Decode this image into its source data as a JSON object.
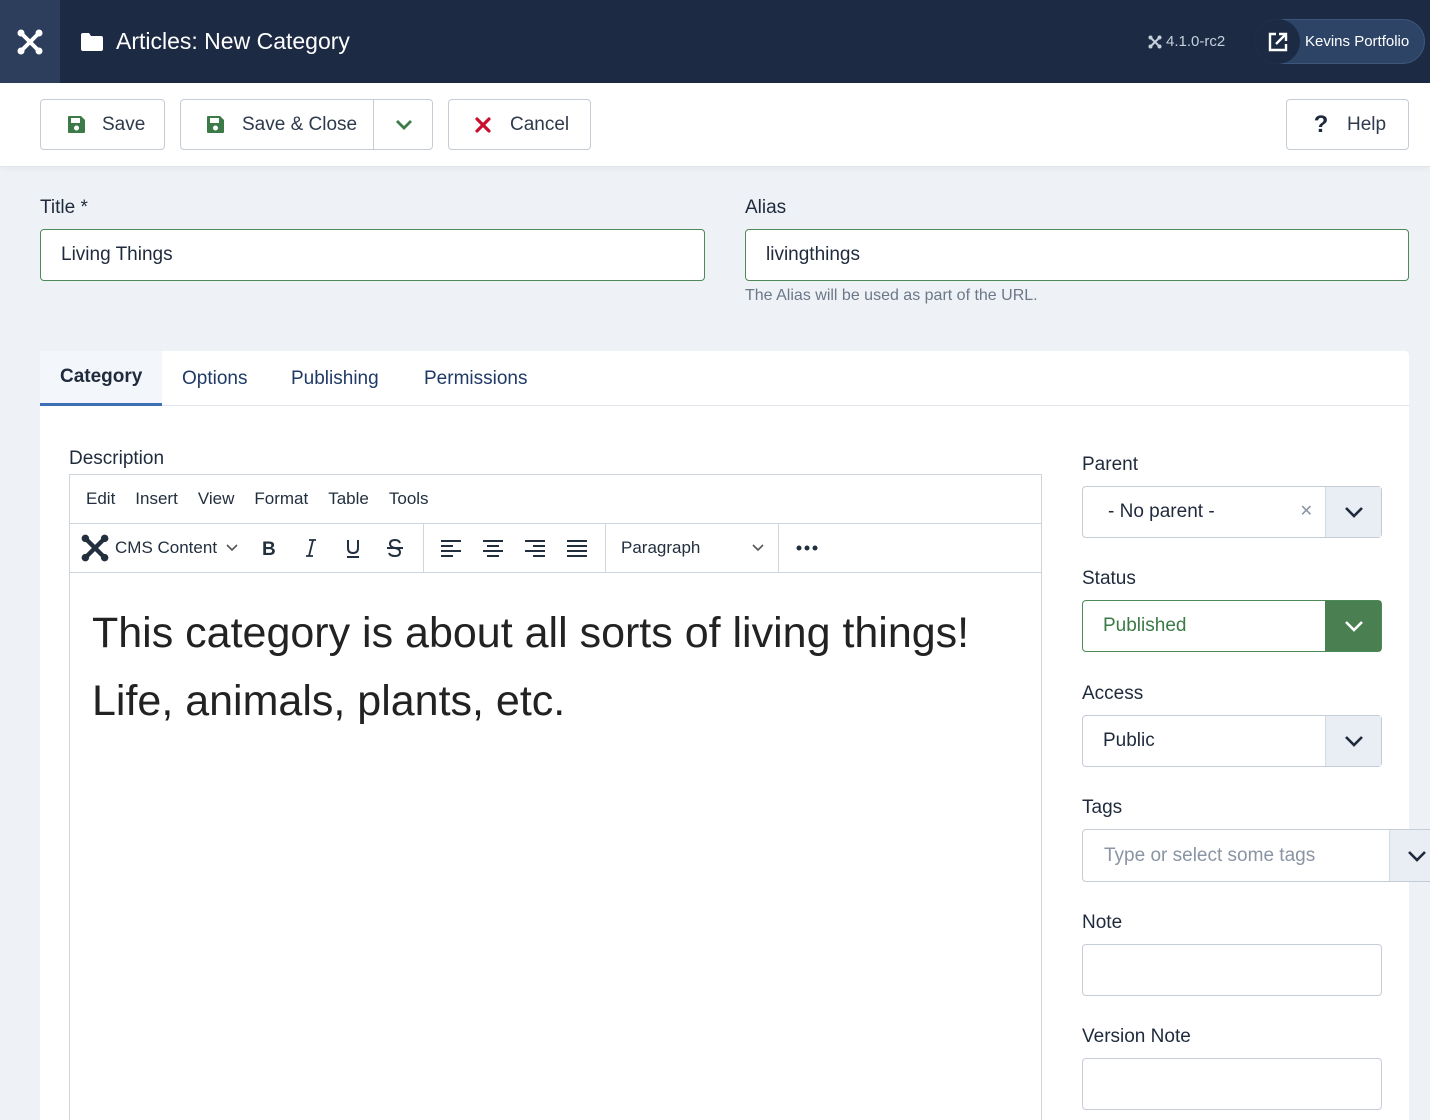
{
  "header": {
    "title": "Articles: New Category",
    "version": "4.1.0-rc2",
    "site_link": "Kevins Portfolio"
  },
  "toolbar": {
    "save_label": "Save",
    "save_close_label": "Save & Close",
    "cancel_label": "Cancel",
    "help_label": "Help"
  },
  "form": {
    "title_label": "Title *",
    "title_value": "Living Things",
    "alias_label": "Alias",
    "alias_value": "livingthings",
    "alias_hint": "The Alias will be used as part of the URL."
  },
  "tabs": [
    "Category",
    "Options",
    "Publishing",
    "Permissions"
  ],
  "editor": {
    "label": "Description",
    "menu": [
      "Edit",
      "Insert",
      "View",
      "Format",
      "Table",
      "Tools"
    ],
    "cms_content": "CMS Content",
    "block_format": "Paragraph",
    "content": "This category is about all sorts of living things! Life, animals, plants, etc."
  },
  "sidebar": {
    "parent_label": "Parent",
    "parent_value": "- No parent -",
    "status_label": "Status",
    "status_value": "Published",
    "access_label": "Access",
    "access_value": "Public",
    "tags_label": "Tags",
    "tags_placeholder": "Type or select some tags",
    "note_label": "Note",
    "version_note_label": "Version Note"
  },
  "colors": {
    "header_bg": "#1c2a43",
    "success": "#4a7f52",
    "danger": "#c8102e",
    "tab_active": "#3c6fb4"
  }
}
